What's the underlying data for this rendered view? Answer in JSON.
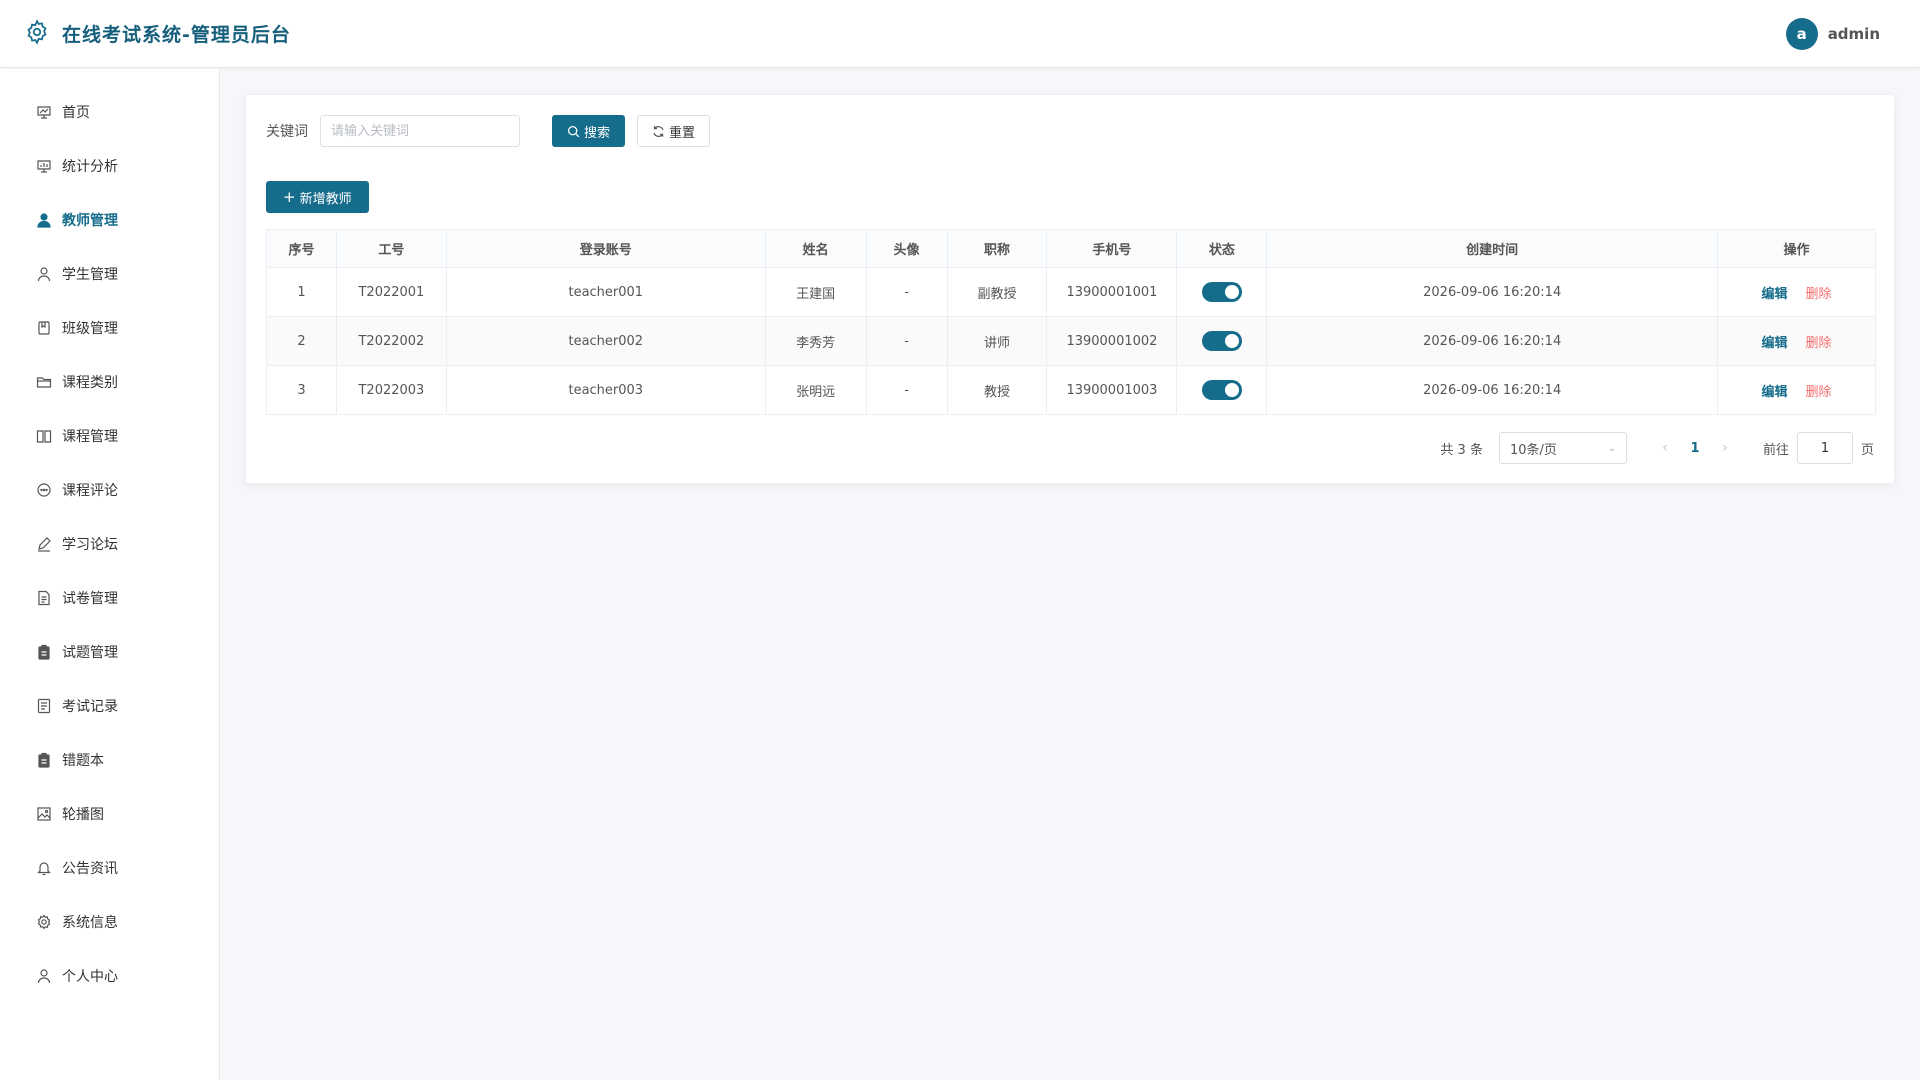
{
  "header": {
    "title": "在线考试系统-管理员后台",
    "avatar_letter": "a",
    "username": "admin"
  },
  "sidebar": {
    "items": [
      {
        "label": "首页",
        "icon": "dashboard-icon"
      },
      {
        "label": "统计分析",
        "icon": "chart-icon"
      },
      {
        "label": "教师管理",
        "icon": "user-fill-icon",
        "active": true
      },
      {
        "label": "学生管理",
        "icon": "user-icon"
      },
      {
        "label": "班级管理",
        "icon": "notebook-icon"
      },
      {
        "label": "课程类别",
        "icon": "folder-icon"
      },
      {
        "label": "课程管理",
        "icon": "book-icon"
      },
      {
        "label": "课程评论",
        "icon": "chat-icon"
      },
      {
        "label": "学习论坛",
        "icon": "pen-icon"
      },
      {
        "label": "试卷管理",
        "icon": "document-icon"
      },
      {
        "label": "试题管理",
        "icon": "clipboard-icon"
      },
      {
        "label": "考试记录",
        "icon": "record-icon"
      },
      {
        "label": "错题本",
        "icon": "clipboard-icon"
      },
      {
        "label": "轮播图",
        "icon": "picture-icon"
      },
      {
        "label": "公告资讯",
        "icon": "bell-icon"
      },
      {
        "label": "系统信息",
        "icon": "gear-icon"
      },
      {
        "label": "个人中心",
        "icon": "user-icon"
      }
    ]
  },
  "search": {
    "label": "关键词",
    "placeholder": "请输入关键词",
    "value": "",
    "search_label": "搜索",
    "reset_label": "重置"
  },
  "toolbar": {
    "add_label": "新增教师"
  },
  "table": {
    "columns": [
      "序号",
      "工号",
      "登录账号",
      "姓名",
      "头像",
      "职称",
      "手机号",
      "状态",
      "创建时间",
      "操作"
    ],
    "rows": [
      {
        "no": "1",
        "job_id": "T2022001",
        "account": "teacher001",
        "name": "王建国",
        "avatar": "-",
        "title": "副教授",
        "phone": "13900001001",
        "enabled": true,
        "created": "2026-09-06 16:20:14"
      },
      {
        "no": "2",
        "job_id": "T2022002",
        "account": "teacher002",
        "name": "李秀芳",
        "avatar": "-",
        "title": "讲师",
        "phone": "13900001002",
        "enabled": true,
        "created": "2026-09-06 16:20:14"
      },
      {
        "no": "3",
        "job_id": "T2022003",
        "account": "teacher003",
        "name": "张明远",
        "avatar": "-",
        "title": "教授",
        "phone": "13900001003",
        "enabled": true,
        "created": "2026-09-06 16:20:14"
      }
    ],
    "edit_label": "编辑",
    "delete_label": "删除"
  },
  "pagination": {
    "total_text": "共 3 条",
    "page_size": "10条/页",
    "current_page": "1",
    "goto_label": "前往",
    "goto_value": "1",
    "page_suffix": "页"
  },
  "colors": {
    "accent": "#166d8b",
    "danger": "#f56c6c"
  }
}
